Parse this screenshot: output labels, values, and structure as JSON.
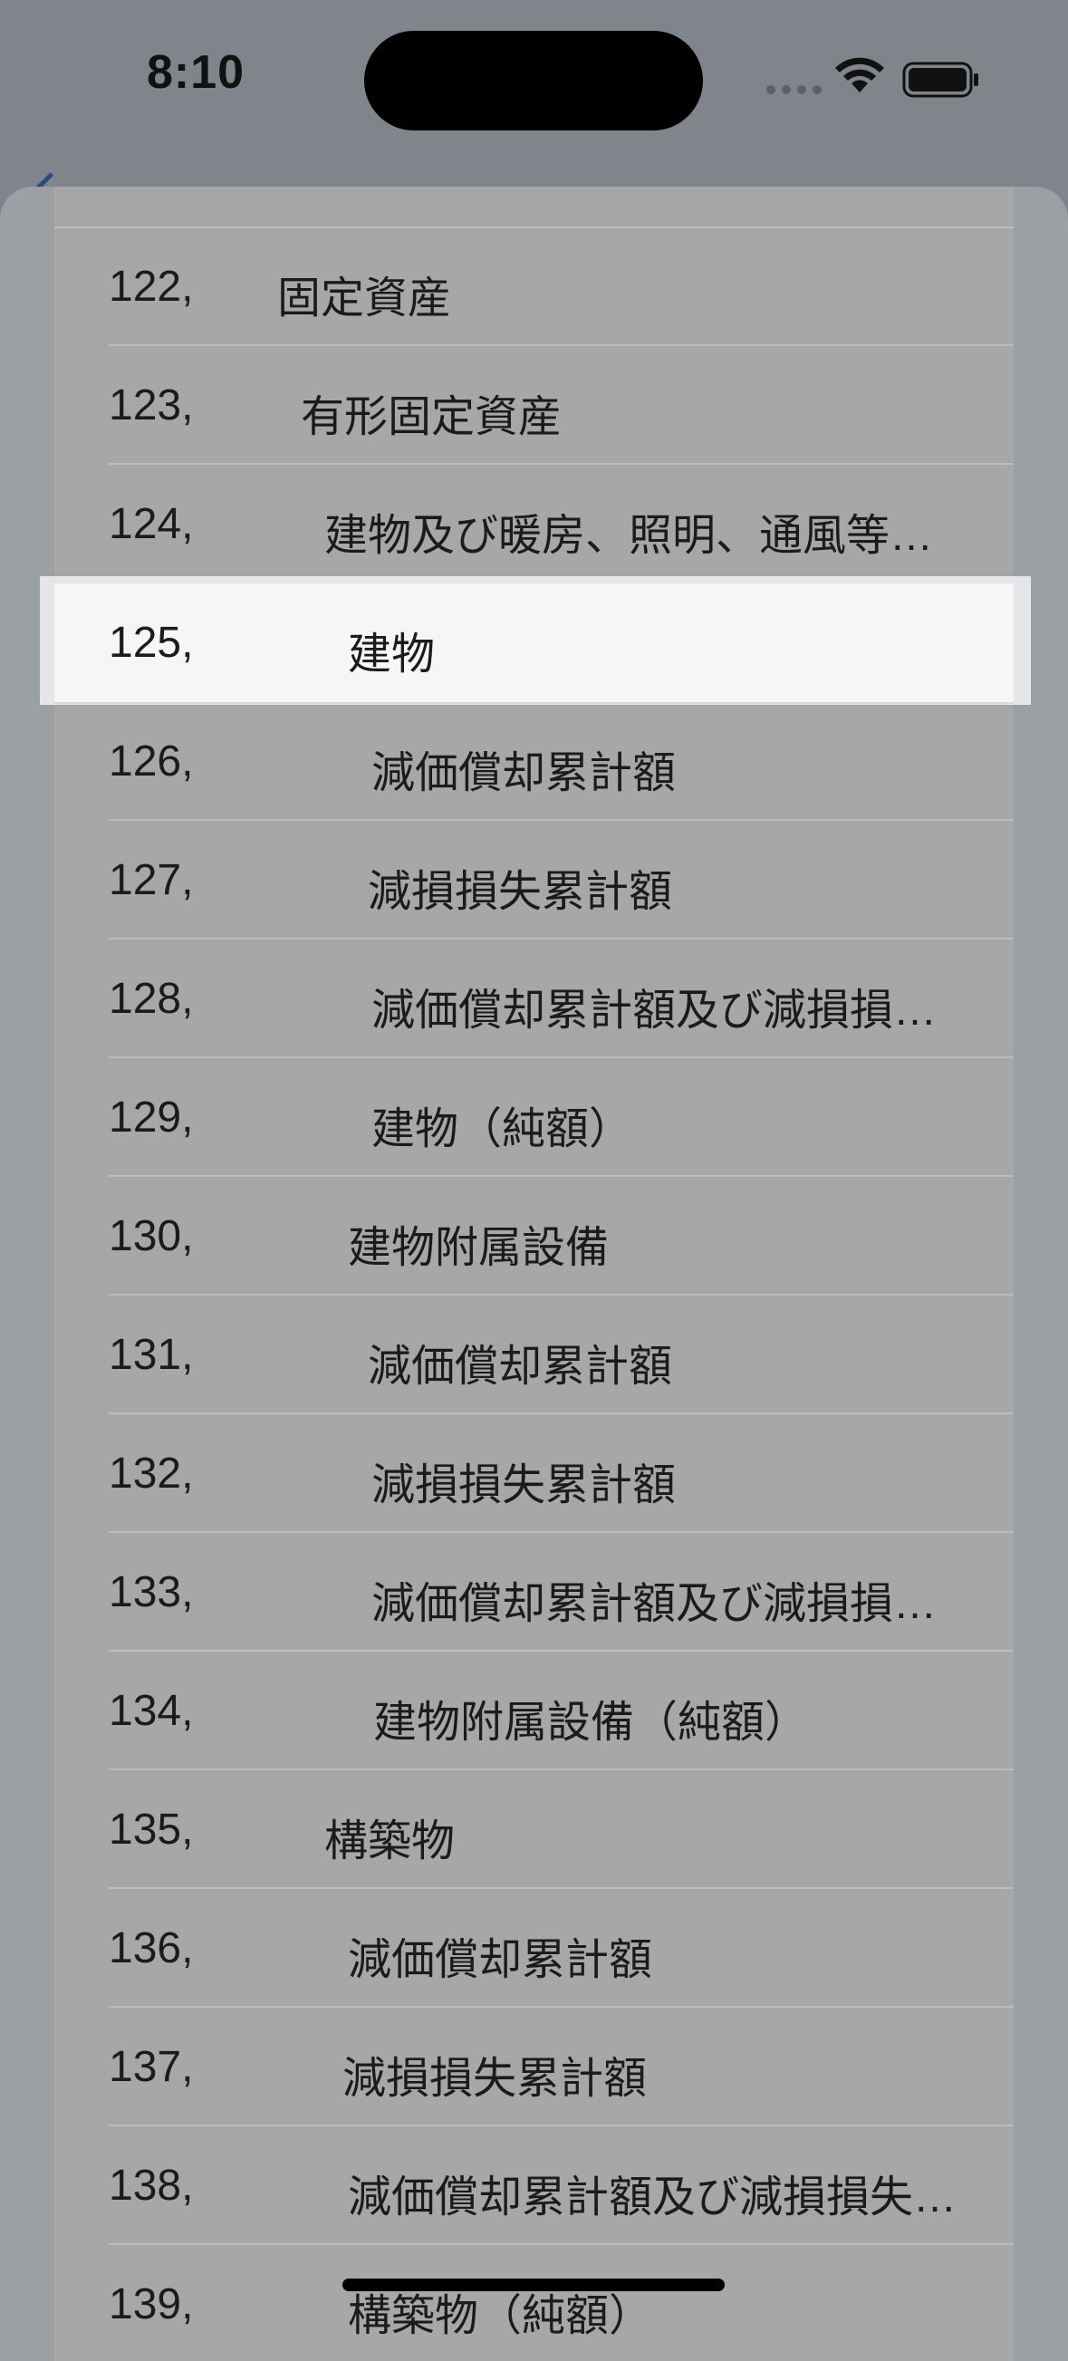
{
  "status_bar": {
    "time": "8:10",
    "wifi_icon": "wifi-icon",
    "battery_icon": "battery-icon"
  },
  "list": {
    "rows": [
      {
        "num": "122,",
        "label": "固定資産"
      },
      {
        "num": "123,",
        "label": "有形固定資産"
      },
      {
        "num": "124,",
        "label": "建物及び暖房、照明、通風等…"
      },
      {
        "num": "125,",
        "label": "建物",
        "selected": true
      },
      {
        "num": "126,",
        "label": "減価償却累計額"
      },
      {
        "num": "127,",
        "label": "減損損失累計額"
      },
      {
        "num": "128,",
        "label": "減価償却累計額及び減損損…"
      },
      {
        "num": "129,",
        "label": "建物（純額）"
      },
      {
        "num": "130,",
        "label": "建物附属設備"
      },
      {
        "num": "131,",
        "label": "減価償却累計額"
      },
      {
        "num": "132,",
        "label": "減損損失累計額"
      },
      {
        "num": "133,",
        "label": "減価償却累計額及び減損損…"
      },
      {
        "num": "134,",
        "label": "建物附属設備（純額）"
      },
      {
        "num": "135,",
        "label": "構築物"
      },
      {
        "num": "136,",
        "label": "減価償却累計額"
      },
      {
        "num": "137,",
        "label": "減損損失累計額"
      },
      {
        "num": "138,",
        "label": "減価償却累計額及び減損損失…"
      },
      {
        "num": "139,",
        "label": "構築物（純額）"
      }
    ]
  }
}
